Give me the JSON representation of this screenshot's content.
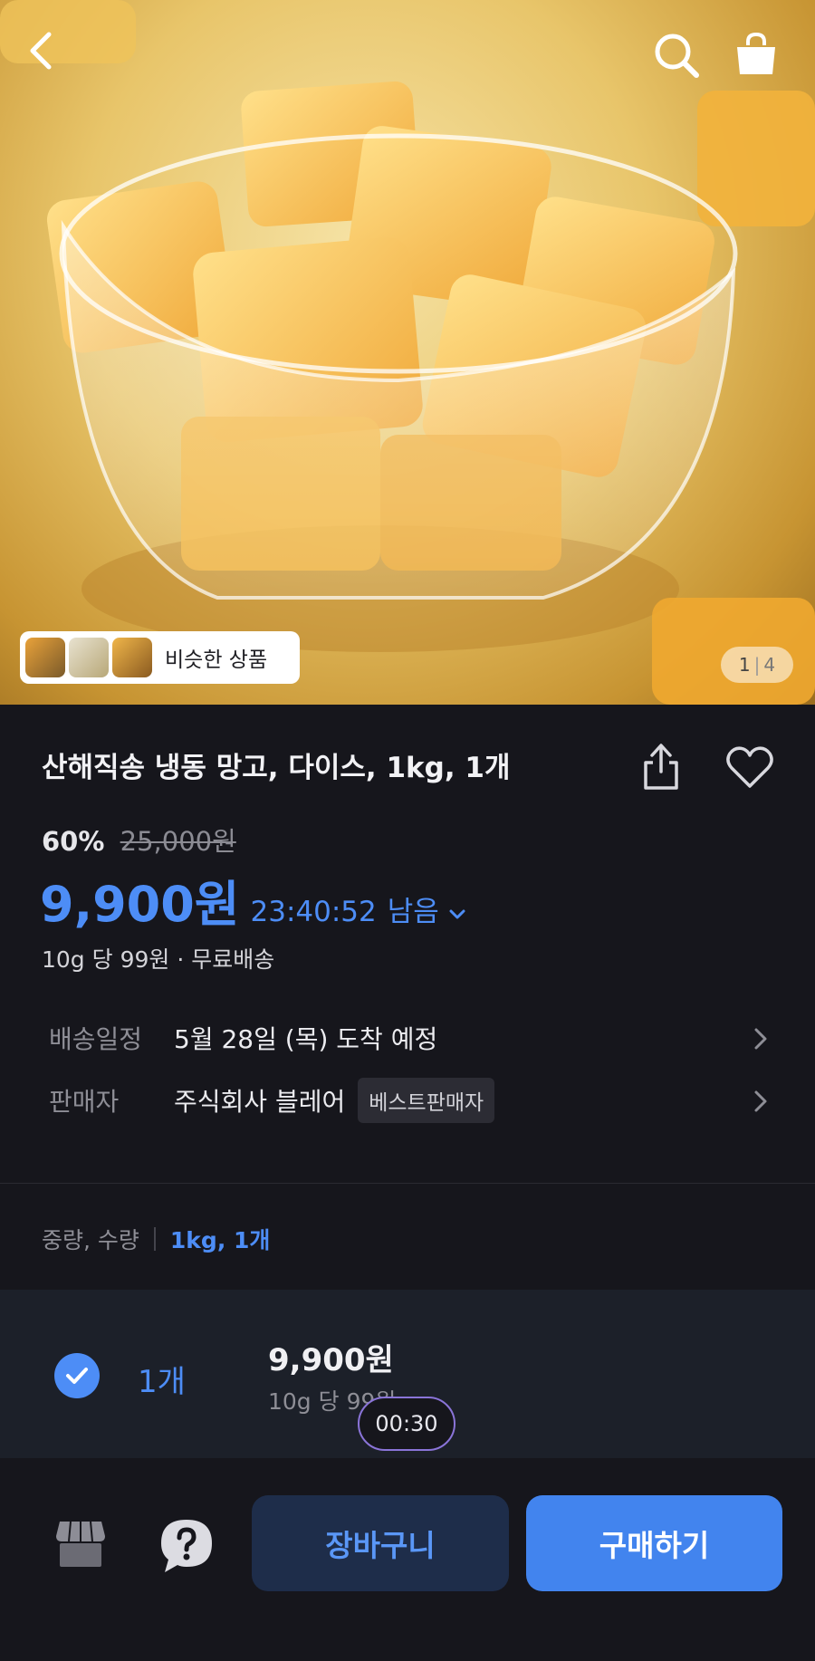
{
  "gallery": {
    "similar_label": "비슷한 상품",
    "current_index": "1",
    "separator": "|",
    "total": "4"
  },
  "product": {
    "title": "산해직송 냉동 망고, 다이스, 1kg, 1개",
    "discount_rate": "60%",
    "original_price": "25,000원",
    "sale_price": "9,900원",
    "countdown": "23:40:52",
    "remain_label": "남음",
    "unit_price_shipping": "10g 당 99원 · 무료배송"
  },
  "delivery": {
    "label": "배송일정",
    "value": "5월 28일 (목) 도착 예정"
  },
  "seller": {
    "label": "판매자",
    "name": "주식회사 블레어",
    "badge": "베스트판매자"
  },
  "option": {
    "label": "중량, 수량",
    "value": "1kg, 1개",
    "quantity": "1개",
    "price": "9,900원",
    "unit_price": "10g 당 99원",
    "timer": "00:30"
  },
  "actions": {
    "cart_label": "장바구니",
    "buy_label": "구매하기"
  },
  "colors": {
    "accent": "#4d8df6",
    "buy_button": "#4284ee",
    "cart_button_bg": "#1e2d4a",
    "background": "#16161c"
  },
  "icons": [
    "back-icon",
    "search-icon",
    "shopping-bag-icon",
    "share-icon",
    "heart-icon",
    "chevron-down-icon",
    "chevron-right-icon",
    "check-icon",
    "store-icon",
    "help-icon"
  ]
}
